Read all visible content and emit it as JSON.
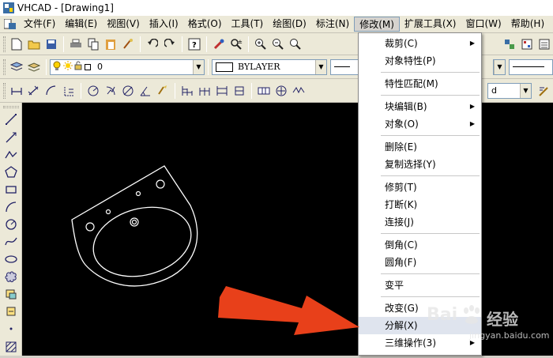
{
  "window": {
    "title": "VHCAD - [Drawing1]"
  },
  "menubar": {
    "items": [
      "文件(F)",
      "编辑(E)",
      "视图(V)",
      "插入(I)",
      "格式(O)",
      "工具(T)",
      "绘图(D)",
      "标注(N)",
      "修改(M)",
      "扩展工具(X)",
      "窗口(W)",
      "帮助(H)"
    ],
    "active_index": 8
  },
  "layer_toolbar": {
    "layer_value": "0",
    "color_value": "BYLAYER"
  },
  "style_toolbar": {
    "partial_value": "d"
  },
  "modify_menu": {
    "items": [
      {
        "label": "裁剪(C)",
        "submenu": true
      },
      {
        "label": "对象特性(P)",
        "submenu": false
      },
      {
        "label": "特性匹配(M)",
        "submenu": false
      },
      {
        "label": "块编辑(B)",
        "submenu": true
      },
      {
        "label": "对象(O)",
        "submenu": true
      },
      {
        "label": "删除(E)",
        "submenu": false
      },
      {
        "label": "复制选择(Y)",
        "submenu": false
      },
      {
        "label": "修剪(T)",
        "submenu": false
      },
      {
        "label": "打断(K)",
        "submenu": false
      },
      {
        "label": "连接(J)",
        "submenu": false
      },
      {
        "label": "倒角(C)",
        "submenu": false
      },
      {
        "label": "圆角(F)",
        "submenu": false
      },
      {
        "label": "变平",
        "submenu": false
      },
      {
        "label": "改变(G)",
        "submenu": false
      },
      {
        "label": "分解(X)",
        "submenu": false,
        "highlighted": true
      },
      {
        "label": "三维操作(3)",
        "submenu": true
      }
    ],
    "separators_after": [
      1,
      2,
      4,
      6,
      9,
      11,
      12
    ]
  },
  "watermark": {
    "brand": "Bai",
    "brand_suffix": "经验",
    "url": "jingyan.baidu.com"
  },
  "colors": {
    "canvas": "#000000",
    "drawing_lines": "#ffffff",
    "arrow": "#e8401a",
    "menu_highlight": "#dfe4ee"
  },
  "icons": {
    "app": "vhcad-app-icon",
    "left_toolbar": [
      "line-icon",
      "ray-icon",
      "polyline-icon",
      "polygon-icon",
      "rectangle-icon",
      "arc-icon",
      "circle-icon",
      "spline-icon",
      "ellipse-icon",
      "revision-cloud-icon",
      "insert-block-icon",
      "make-block-icon",
      "point-icon",
      "hatch-icon"
    ]
  }
}
